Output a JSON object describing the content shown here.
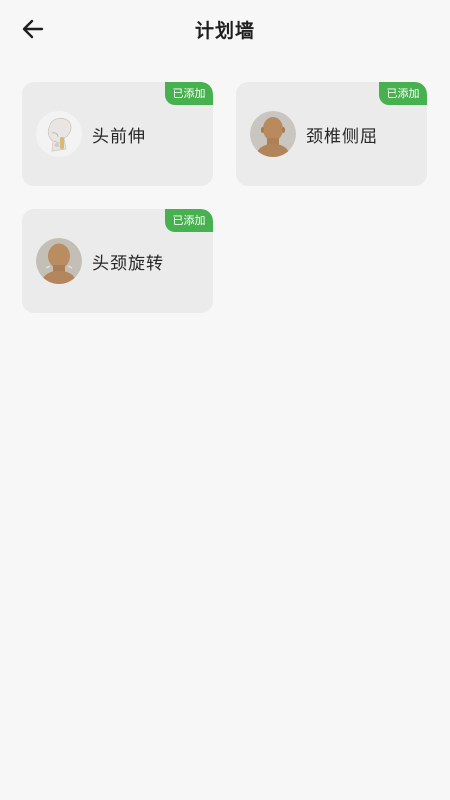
{
  "header": {
    "title": "计划墙",
    "back_icon": "arrow-left-icon"
  },
  "cards": [
    {
      "label": "头前伸",
      "badge": "已添加",
      "image": "neck-skeleton-image"
    },
    {
      "label": "颈椎侧屈",
      "badge": "已添加",
      "image": "head-front-image"
    },
    {
      "label": "头颈旋转",
      "badge": "已添加",
      "image": "head-back-image"
    }
  ],
  "colors": {
    "badge_green": "#48b14f",
    "card_bg": "#ebebeb",
    "page_bg": "#f7f7f7"
  }
}
